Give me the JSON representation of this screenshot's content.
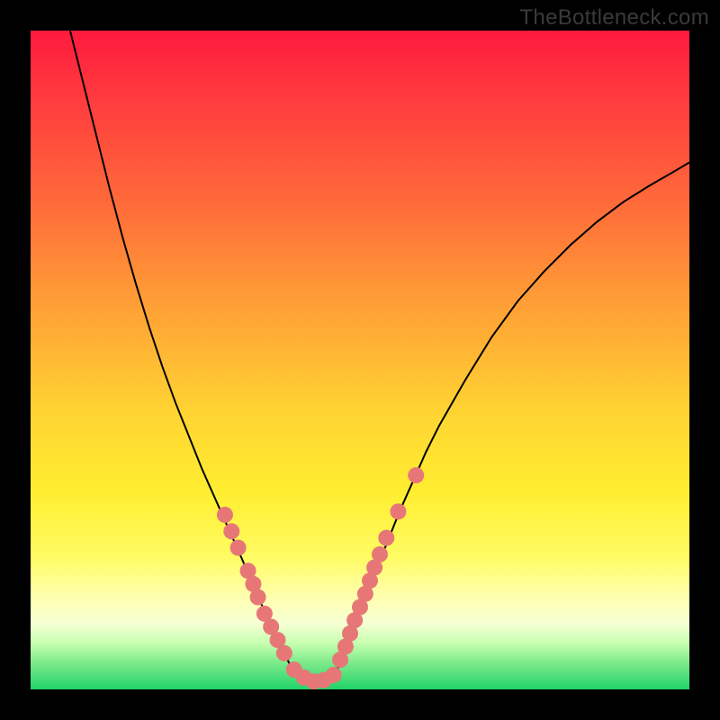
{
  "watermark": "TheBottleneck.com",
  "colors": {
    "curve": "#000000",
    "dots": "#e77777",
    "background_top": "#ff1a3e",
    "background_bottom": "#21d36a"
  },
  "chart_data": {
    "type": "line",
    "title": "",
    "xlabel": "",
    "ylabel": "",
    "xlim": [
      0,
      100
    ],
    "ylim": [
      0,
      100
    ],
    "left_curve": {
      "x": [
        6,
        8,
        10,
        12,
        14,
        16,
        18,
        20,
        22,
        24,
        26,
        28,
        30,
        32,
        33.5,
        35,
        36.5,
        38,
        39,
        40
      ],
      "y": [
        100,
        92,
        84,
        76,
        68.5,
        61.5,
        55,
        49,
        43.5,
        38.5,
        33.5,
        29,
        24.5,
        20,
        16.5,
        13,
        10,
        7,
        4.5,
        2.5
      ]
    },
    "right_curve": {
      "x": [
        46,
        47,
        48,
        49,
        50,
        52,
        54,
        56,
        58,
        60,
        62,
        66,
        70,
        74,
        78,
        82,
        86,
        90,
        94,
        98,
        100
      ],
      "y": [
        2,
        4,
        6.5,
        9,
        12,
        17,
        22,
        27,
        31.5,
        36,
        40,
        47,
        53.5,
        59,
        63.5,
        67.5,
        71,
        74,
        76.5,
        78.8,
        80
      ]
    },
    "valley_floor": {
      "x": [
        40,
        41,
        42,
        43,
        44,
        45,
        46
      ],
      "y": [
        2.5,
        1.6,
        1.2,
        1.0,
        1.1,
        1.4,
        2.0
      ]
    },
    "dots": [
      {
        "x": 29.5,
        "y": 26.5
      },
      {
        "x": 30.5,
        "y": 24.0
      },
      {
        "x": 31.5,
        "y": 21.5
      },
      {
        "x": 33.0,
        "y": 18.0
      },
      {
        "x": 33.8,
        "y": 16.0
      },
      {
        "x": 34.5,
        "y": 14.0
      },
      {
        "x": 35.5,
        "y": 11.5
      },
      {
        "x": 36.5,
        "y": 9.5
      },
      {
        "x": 37.5,
        "y": 7.5
      },
      {
        "x": 38.5,
        "y": 5.5
      },
      {
        "x": 40.0,
        "y": 3.0
      },
      {
        "x": 41.5,
        "y": 1.8
      },
      {
        "x": 43.0,
        "y": 1.2
      },
      {
        "x": 44.5,
        "y": 1.4
      },
      {
        "x": 46.0,
        "y": 2.2
      },
      {
        "x": 47.0,
        "y": 4.5
      },
      {
        "x": 47.8,
        "y": 6.5
      },
      {
        "x": 48.5,
        "y": 8.5
      },
      {
        "x": 49.2,
        "y": 10.5
      },
      {
        "x": 50.0,
        "y": 12.5
      },
      {
        "x": 50.8,
        "y": 14.5
      },
      {
        "x": 51.5,
        "y": 16.5
      },
      {
        "x": 52.2,
        "y": 18.5
      },
      {
        "x": 53.0,
        "y": 20.5
      },
      {
        "x": 54.0,
        "y": 23.0
      },
      {
        "x": 55.8,
        "y": 27.0
      },
      {
        "x": 58.5,
        "y": 32.5
      }
    ]
  }
}
